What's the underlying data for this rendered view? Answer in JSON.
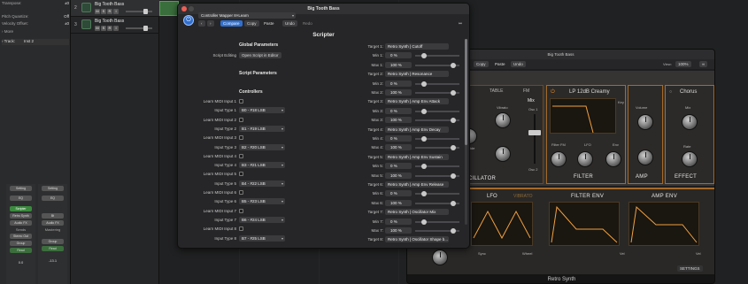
{
  "inspector": {
    "rows": [
      {
        "label": "Transpose:",
        "value": "±0"
      },
      {
        "label": "Pitch Quantize:",
        "value": "Off"
      },
      {
        "label": "Velocity Offset:",
        "value": "±0"
      },
      {
        "label": "› More",
        "value": ""
      },
      {
        "label": "› Track:",
        "value": "Inst 2"
      }
    ],
    "strips": [
      {
        "setting": "Setting",
        "eq": "EQ",
        "input": "Scripter",
        "mid": "Retro Synth",
        "output": "Audio FX",
        "sends": "Sends",
        "out": "Stereo Out",
        "group": "Group",
        "read": "Read",
        "m": "M",
        "s": "S",
        "name": "Inst 2"
      },
      {
        "setting": "Setting",
        "eq": "EQ",
        "input": "",
        "mid": "Bt",
        "output": "Audio FX",
        "sends": "Mastering",
        "out": "",
        "group": "Group",
        "read": "Read",
        "m": "M",
        "s": "S",
        "name": "Stereo Out"
      }
    ],
    "volume_left": "0.0",
    "volume_right": "-13.1"
  },
  "tracks": [
    {
      "num": "2",
      "name": "Big Tooth Bass",
      "m": "M",
      "s": "S",
      "r": "R",
      "i": "I"
    },
    {
      "num": "3",
      "name": "Big Tooth Bass",
      "m": "M",
      "s": "S",
      "r": "R",
      "i": "I"
    }
  ],
  "scripter": {
    "window_title": "Big Tooth Bass",
    "preset": "Controller Mapper 8×Learn",
    "tabs": [
      "Compare",
      "Copy",
      "Paste",
      "Undo",
      "Redo"
    ],
    "title": "Scripter",
    "global_header": "Global Parameters",
    "script_editing_label": "Script Editing",
    "script_editing_button": "Open Script in Editor",
    "script_params_header": "Script Parameters",
    "controllers_header": "Controllers",
    "left_rows": [
      {
        "label": "Learn MIDI Input 1"
      },
      {
        "label": "Input Type 1",
        "value": "B0 - #18 LSB"
      },
      {
        "label": "Learn MIDI Input 2"
      },
      {
        "label": "Input Type 2",
        "value": "B1 - #19 LSB"
      },
      {
        "label": "Learn MIDI Input 3"
      },
      {
        "label": "Input Type 3",
        "value": "B2 - #20 LSB"
      },
      {
        "label": "Learn MIDI Input 4"
      },
      {
        "label": "Input Type 4",
        "value": "B3 - #21 LSB"
      },
      {
        "label": "Learn MIDI Input 5"
      },
      {
        "label": "Input Type 5",
        "value": "B4 - #22 LSB"
      },
      {
        "label": "Learn MIDI Input 6"
      },
      {
        "label": "Input Type 6",
        "value": "B5 - #23 LSB"
      },
      {
        "label": "Learn MIDI Input 7"
      },
      {
        "label": "Input Type 7",
        "value": "B6 - #24 LSB"
      },
      {
        "label": "Learn MIDI Input 8"
      },
      {
        "label": "Input Type 8",
        "value": "B7 - #25 LSB"
      }
    ],
    "right_rows": [
      {
        "label": "Target 1:",
        "type": "target",
        "value": "Retro Synth | Cutoff"
      },
      {
        "label": "Min 1:",
        "type": "mini",
        "value": "0 %",
        "slider": 0.15
      },
      {
        "label": "Max 1:",
        "type": "mini",
        "value": "100 %",
        "slider": 0.9
      },
      {
        "label": "Target 2:",
        "type": "target",
        "value": "Retro Synth | Resonance"
      },
      {
        "label": "Min 2:",
        "type": "mini",
        "value": "0 %",
        "slider": 0.15
      },
      {
        "label": "Max 2:",
        "type": "mini",
        "value": "100 %",
        "slider": 0.9
      },
      {
        "label": "Target 3:",
        "type": "target",
        "value": "Retro Synth | Amp Env Attack"
      },
      {
        "label": "Min 3:",
        "type": "mini",
        "value": "0 %",
        "slider": 0.15
      },
      {
        "label": "Max 3:",
        "type": "mini",
        "value": "100 %",
        "slider": 0.9
      },
      {
        "label": "Target 4:",
        "type": "target",
        "value": "Retro Synth | Amp Env Decay"
      },
      {
        "label": "Min 4:",
        "type": "mini",
        "value": "0 %",
        "slider": 0.15
      },
      {
        "label": "Max 4:",
        "type": "mini",
        "value": "100 %",
        "slider": 0.9
      },
      {
        "label": "Target 5:",
        "type": "target",
        "value": "Retro Synth | Amp Env Sustain"
      },
      {
        "label": "Min 5:",
        "type": "mini",
        "value": "0 %",
        "slider": 0.15
      },
      {
        "label": "Max 5:",
        "type": "mini",
        "value": "100 %",
        "slider": 0.9
      },
      {
        "label": "Target 6:",
        "type": "target",
        "value": "Retro Synth | Amp Env Release"
      },
      {
        "label": "Min 6:",
        "type": "mini",
        "value": "0 %",
        "slider": 0.15
      },
      {
        "label": "Max 6:",
        "type": "mini",
        "value": "100 %",
        "slider": 0.9
      },
      {
        "label": "Target 7:",
        "type": "target",
        "value": "Retro Synth | Oscillator Mix"
      },
      {
        "label": "Min 7:",
        "type": "mini",
        "value": "0 %",
        "slider": 0.15
      },
      {
        "label": "Max 7:",
        "type": "mini",
        "value": "100 %",
        "slider": 0.9
      },
      {
        "label": "Target 8:",
        "type": "target",
        "value": "Retro Synth | Oscillator Shape b..."
      }
    ]
  },
  "retro": {
    "window_title": "Big Tooth Bass",
    "tabs": [
      "Copy",
      "Paste",
      "Undo"
    ],
    "view_label": "View:",
    "view_value": "100%",
    "filter_name": "LP 12dB Creamy",
    "chorus_name": "Chorus",
    "sections": [
      "FILTER",
      "AMP",
      "EFFECT",
      "LFO",
      "FILTER ENV",
      "AMP ENV"
    ],
    "osc_partial": "CILLATOR",
    "table_tab": "TABLE",
    "fm_tab": "FM",
    "mix_label": "Mix",
    "osc1": "Osc 1",
    "osc2": "Osc 2",
    "knob_labels": [
      "Glide",
      "Vibrato",
      "Volume",
      "Mix",
      "Filter FM",
      "LFO",
      "Env",
      "Key",
      "Rate",
      "Glide",
      "Detune"
    ],
    "env_labels": [
      "A",
      "D",
      "S",
      "R"
    ],
    "sync_label": "Sync",
    "wheel_label": "Wheel",
    "vel_label": "Vel",
    "settings_label": "SETTINGS",
    "footer": "Retro Synth",
    "lfo_label": "LFO",
    "vibrato_label": "VIBRATO"
  }
}
